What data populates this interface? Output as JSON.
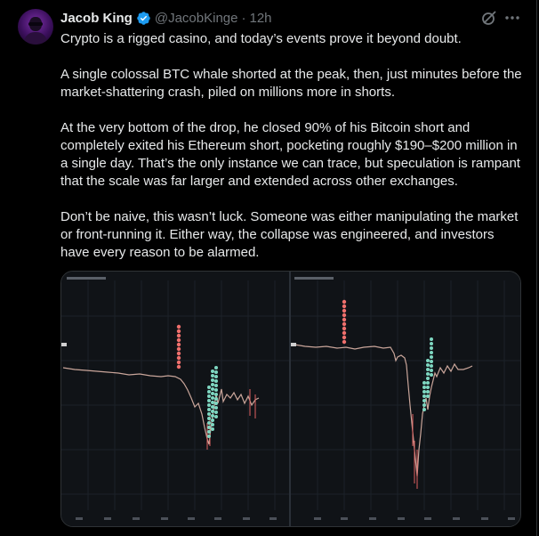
{
  "author": {
    "name": "Jacob King",
    "handle": "@JacobKinge",
    "separator": "·",
    "time": "12h"
  },
  "icons": {
    "verified": "verified-badge-icon",
    "grok": "grok-icon",
    "more": "more-options-icon"
  },
  "colors": {
    "background": "#000000",
    "text": "#e7e9ea",
    "muted": "#71767b",
    "verified": "#1d9bf0",
    "short_marker": "#ef6f6c",
    "long_marker": "#7ed7c1"
  },
  "tweet": {
    "paragraphs": [
      "Crypto is a rigged casino, and today’s events prove it beyond doubt.",
      "A single colossal BTC whale shorted at the peak, then, just minutes before the market-shattering crash, piled on millions more in shorts.",
      "At the very bottom of the drop, he closed 90% of his Bitcoin short and completely exited his Ethereum short, pocketing roughly $190–$200 million in a single day. That’s the only instance we can trace, but speculation is rampant that the scale was far larger and extended across other exchanges.",
      "Don’t be naive, this wasn’t luck. Someone was either manipulating the market or front-running it. Either way, the collapse was engineered, and investors have every reason to be alarmed."
    ]
  }
}
